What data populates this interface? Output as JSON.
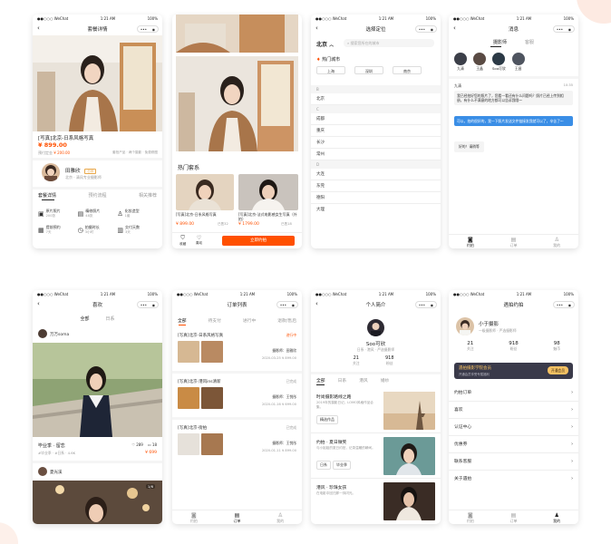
{
  "status": {
    "carrier": "●●○○○ WeChat",
    "time": "1:21 AM",
    "battery": "100%"
  },
  "icons": {
    "back": "chevron-left-icon",
    "more": "more-dots-icon",
    "close": "target-close-icon"
  },
  "colors": {
    "accent": "#ff5000",
    "blue": "#3a8ee6",
    "dark": "#3a3a4a",
    "gold": "#f5c163"
  },
  "s1": {
    "title": "套餐详情",
    "product": "[写真]北京-日系风格写真",
    "price": "¥ 899.00",
    "orig_label": "预付定金",
    "orig_price": "¥ 200.00",
    "meta": "套拍产品 · 两个摄影 · 免费修图",
    "photographer": "田雅欣",
    "ph_badge": "日系",
    "ph_desc": "北京 · 清风专业摄影师",
    "tabs": [
      "套餐详情",
      "预约流程",
      "相关推荐"
    ],
    "features": [
      {
        "label": "原片照片",
        "sub": "200张"
      },
      {
        "label": "精修照片",
        "sub": "48张"
      },
      {
        "label": "化妆造型",
        "sub": "1套"
      },
      {
        "label": "提前预约",
        "sub": "7天"
      },
      {
        "label": "拍摄时长",
        "sub": "3小时"
      },
      {
        "label": "交付天数",
        "sub": "3天"
      }
    ]
  },
  "s2": {
    "section": "热门套系",
    "items": [
      {
        "title": "[写真]北京-日系风格写真",
        "price": "¥ 899.00",
        "sold": "已售32"
      },
      {
        "title": "[写真]北京-法式电影感女生写真（外拍）",
        "price": "¥ 1799.00",
        "sold": "已售18"
      }
    ],
    "fav": "收藏",
    "like": "喜欢",
    "book": "立即约拍"
  },
  "s3": {
    "title": "选择定位",
    "city": "北京",
    "search_placeholder": "搜索您所在的城市",
    "hot_label": "热门城市",
    "hot": [
      "上海",
      "深圳",
      "南京"
    ],
    "groups": [
      {
        "letter": "B",
        "cities": [
          "北京"
        ]
      },
      {
        "letter": "C",
        "cities": [
          "成都",
          "重庆",
          "长沙",
          "常州"
        ]
      },
      {
        "letter": "D",
        "cities": [
          "大连",
          "东莞",
          "德阳",
          "大理"
        ]
      }
    ]
  },
  "s4": {
    "title": "消息",
    "tabs": [
      "摄影师",
      "客服"
    ],
    "avatars": [
      "九清",
      "王晶",
      "Soo可欣",
      "王昌"
    ],
    "sender": "九清",
    "time": "10:35",
    "msg1": "我已经拍好您的照片了，您看一看还有什么问题吗？照片已经上传到相册，有什么不满意的地方都可以告诉我哦～",
    "msg2": "可以，拍的很好的，我一下照片发送文件链接发我就可以了，辛苦了～",
    "msg3": "好的！请稍等",
    "tabbar": [
      "约拍",
      "订单",
      "我的"
    ]
  },
  "s5": {
    "title": "喜欢",
    "tabs": [
      "全部",
      "日系"
    ],
    "user1": "万万soma",
    "post_title": "毕业季 · 留恋",
    "post_meta": "#毕业季 · #日系 · 4.6K",
    "likes": "289",
    "comments": "18",
    "price": "¥ 699",
    "user2": "夏光溪",
    "page": "1/6"
  },
  "s6": {
    "title": "订单列表",
    "tabs": [
      "全部",
      "待支付",
      "进行中",
      "退款/售后"
    ],
    "orders": [
      {
        "title": "[写真]北京-日系风格写真",
        "status": "进行中",
        "photographer": "摄影师：田雅欣",
        "date": "2020-03-25",
        "price": "¥ 899.00"
      },
      {
        "title": "[写真]北京-港风ins清新",
        "status": "已完成",
        "photographer": "摄影师：王悦彤",
        "date": "2020-01-16",
        "price": "¥ 699.00"
      },
      {
        "title": "[写真]北京-街拍",
        "status": "已完成",
        "photographer": "摄影师：王悦彤",
        "date": "2020-01-11",
        "price": "¥ 899.00"
      }
    ],
    "tabbar": [
      "约拍",
      "订单",
      "我的"
    ]
  },
  "s7": {
    "title": "个人简介",
    "name": "Soo可欣",
    "desc": "日系 · 港风 · 严选摄影师",
    "follow_n": "21",
    "follow_l": "关注",
    "fans_n": "918",
    "fans_l": "粉丝",
    "tabs": [
      "全部",
      "日系",
      "港风",
      "婚纱"
    ],
    "posts": [
      {
        "title": "时尚摄影路线之路",
        "desc": "2019年的摄影日记，LOMO风格作品合集。",
        "tags": [
          "精选作品"
        ]
      },
      {
        "title": "约拍 · 夏日微笑",
        "desc": "与小姐姐的夏日约拍，记录温暖的瞬间。",
        "tags": [
          "日系",
          "毕业季"
        ]
      },
      {
        "title": "港风 · 珍珠女孩",
        "desc": "在电影中回归那一抹闪光。",
        "tags": []
      }
    ]
  },
  "s8": {
    "title": "遇拍约拍",
    "name": "小于摄影",
    "desc": "一级摄影师 · 严选摄影师",
    "stats": [
      {
        "n": "21",
        "l": "关注"
      },
      {
        "n": "918",
        "l": "粉丝"
      },
      {
        "n": "98",
        "l": "魅币"
      }
    ],
    "member_title": "遇拍摄影学院会员",
    "member_sub": "开通会员享受专属福利",
    "member_btn": "开通会员",
    "menu": [
      "约拍订单",
      "喜欢",
      "认证中心",
      "优惠券",
      "联系客服",
      "关于遇拍"
    ],
    "tabbar": [
      "约拍",
      "订单",
      "我的"
    ]
  }
}
